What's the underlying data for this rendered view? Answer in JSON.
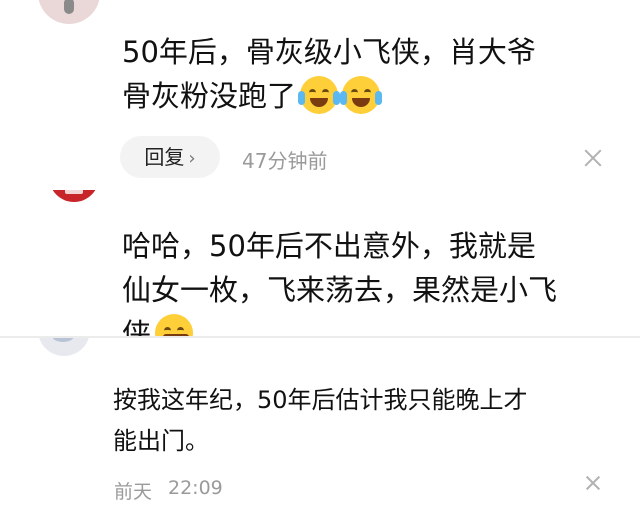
{
  "comments": [
    {
      "text_line1": "50年后，骨灰级小飞侠，肖大爷",
      "text_line2": "骨灰粉没跑了",
      "emojis": [
        "laugh-cry-emoji",
        "laugh-cry-emoji"
      ],
      "reply_label": "回复",
      "time": "47分钟前"
    },
    {
      "text_line1": "哈哈，50年后不出意外，我就是",
      "text_line2": "仙女一枚，飞来荡去，果然是小飞",
      "text_line3": "侠",
      "emojis": [
        "grin-emoji"
      ]
    },
    {
      "text_line1": "按我这年纪，50年后估计我只能晚上才",
      "text_line2": "能出门。",
      "date": "前天",
      "time": "22:09"
    }
  ],
  "colors": {
    "text": "#111111",
    "meta": "#9a9a9a",
    "reply_bg": "#f3f3f3",
    "emoji": "#ffcf3a",
    "avatar2": "#c8252a"
  }
}
